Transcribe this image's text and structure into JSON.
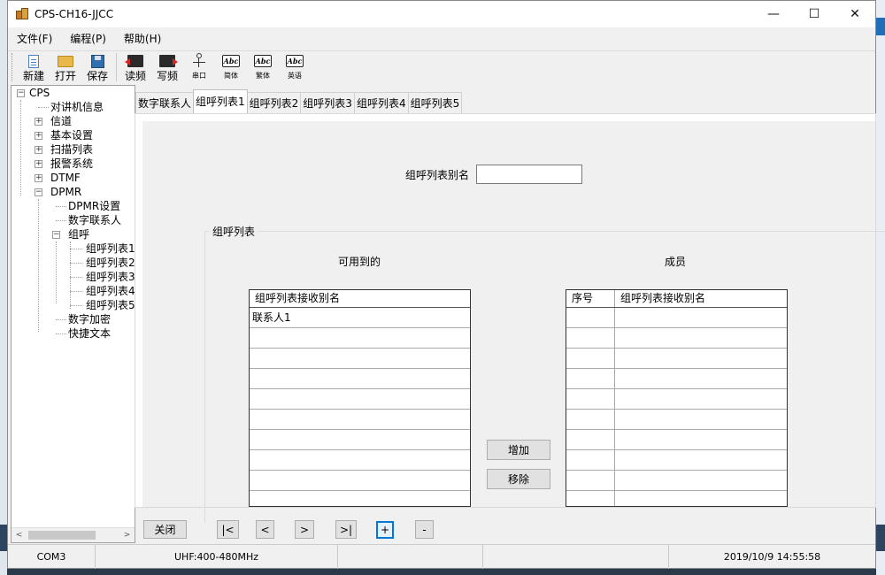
{
  "window": {
    "title": "CPS-CH16-JJCC",
    "min": "—",
    "max": "☐",
    "close": "✕"
  },
  "menu": [
    "文件(F)",
    "编程(P)",
    "帮助(H)"
  ],
  "toolbar": {
    "new": "新建",
    "open": "打开",
    "save": "保存",
    "read": "读频",
    "write": "写频",
    "port": "串口",
    "simplified": "简体",
    "traditional": "繁体",
    "english": "英语",
    "abc": "Abc"
  },
  "tree": {
    "root": "CPS",
    "radio_info": "对讲机信息",
    "channel": "信道",
    "basic": "基本设置",
    "scan": "扫描列表",
    "alarm": "报警系统",
    "dtmf": "DTMF",
    "dpmr": "DPMR",
    "dpmr_settings": "DPMR设置",
    "digital_contacts": "数字联系人",
    "group_call": "组呼",
    "group_lists": [
      "组呼列表1",
      "组呼列表2",
      "组呼列表3",
      "组呼列表4",
      "组呼列表5"
    ],
    "digital_encrypt": "数字加密",
    "quick_text": "快捷文本",
    "expand": "+",
    "collapse": "−",
    "scroll_left": "<",
    "scroll_right": ">"
  },
  "tabs": [
    "数字联系人",
    "组呼列表1",
    "组呼列表2",
    "组呼列表3",
    "组呼列表4",
    "组呼列表5"
  ],
  "form": {
    "alias_label": "组呼列表别名",
    "alias_value": "",
    "group_title": "组呼列表",
    "available_title": "可用到的",
    "members_title": "成员",
    "available_header": "组呼列表接收别名",
    "available_rows": [
      "联系人1",
      "",
      "",
      "",
      "",
      "",
      "",
      "",
      "",
      ""
    ],
    "members_header_no": "序号",
    "members_header_alias": "组呼列表接收别名",
    "add": "增加",
    "remove": "移除"
  },
  "nav": {
    "close": "关闭",
    "first": "|<",
    "prev": "<",
    "next": ">",
    "last": ">|",
    "add": "+",
    "delete": "-"
  },
  "status": {
    "port": "COM3",
    "band": "UHF:400-480MHz",
    "cell3": "",
    "cell4": "",
    "datetime": "2019/10/9 14:55:58"
  }
}
